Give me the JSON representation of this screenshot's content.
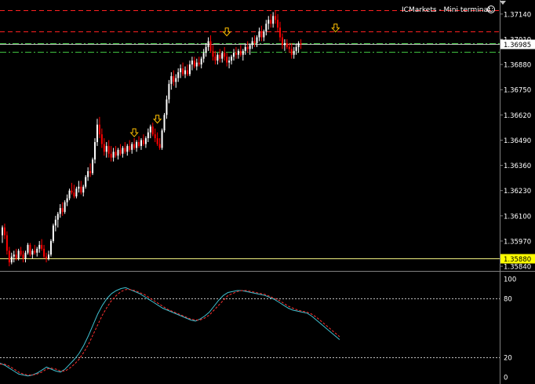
{
  "window": {
    "title": "ICMarkets - Mini terminal",
    "smiley_icon": "smiley-face-icon"
  },
  "colors": {
    "background": "#000000",
    "bull_candle": "#ffffff",
    "bear_candle": "#ff0000",
    "resistance_line": "#ff2020",
    "support_line": "#40c040",
    "current_price_line": "#ffffff",
    "bid_line": "#ffffff",
    "low_price_line": "#f0f080",
    "low_price_tag_bg": "#ffff00",
    "arrow_color": "#ffc000",
    "stoch_main": "#40c0d0",
    "stoch_signal": "#ff3030",
    "axis_text": "#ffffff"
  },
  "chart_data": [
    {
      "type": "candlestick",
      "title": "",
      "price_axis_ticks": [
        "1.37140",
        "1.37010",
        "1.36880",
        "1.36750",
        "1.36620",
        "1.36490",
        "1.36360",
        "1.36230",
        "1.36100",
        "1.35970",
        "1.35840"
      ],
      "ylim": [
        1.3582,
        1.3718
      ],
      "current_price": "1.36985",
      "current_price_value": 1.36985,
      "low_price_tag": "1.35880",
      "low_price_value": 1.3588,
      "horizontal_levels": [
        {
          "kind": "resistance",
          "value": 1.3716
        },
        {
          "kind": "resistance",
          "value": 1.3705
        },
        {
          "kind": "support",
          "value": 1.3699
        },
        {
          "kind": "support",
          "value": 1.36945
        }
      ],
      "down_arrows": [
        {
          "bar": 57,
          "price": 1.3652
        },
        {
          "bar": 67,
          "price": 1.3659
        },
        {
          "bar": 97,
          "price": 1.3704
        },
        {
          "bar": 144,
          "price": 1.3706
        }
      ],
      "bars": [
        [
          1.36,
          1.3605,
          1.3596,
          1.3604
        ],
        [
          1.3604,
          1.3606,
          1.3598,
          1.36
        ],
        [
          1.36,
          1.3602,
          1.359,
          1.3592
        ],
        [
          1.3592,
          1.3594,
          1.3584,
          1.3586
        ],
        [
          1.3586,
          1.3591,
          1.3585,
          1.3589
        ],
        [
          1.3589,
          1.3592,
          1.3586,
          1.359
        ],
        [
          1.359,
          1.3593,
          1.3587,
          1.3588
        ],
        [
          1.3588,
          1.3593,
          1.3587,
          1.3592
        ],
        [
          1.3592,
          1.3594,
          1.3589,
          1.359
        ],
        [
          1.359,
          1.3592,
          1.3586,
          1.3588
        ],
        [
          1.3588,
          1.3592,
          1.3586,
          1.3591
        ],
        [
          1.3591,
          1.3596,
          1.359,
          1.3595
        ],
        [
          1.3595,
          1.3596,
          1.3589,
          1.359
        ],
        [
          1.359,
          1.3593,
          1.3588,
          1.3592
        ],
        [
          1.3592,
          1.3595,
          1.359,
          1.3591
        ],
        [
          1.3591,
          1.3594,
          1.3589,
          1.3593
        ],
        [
          1.3593,
          1.3597,
          1.3591,
          1.3595
        ],
        [
          1.3595,
          1.3598,
          1.3592,
          1.3593
        ],
        [
          1.3593,
          1.3595,
          1.3588,
          1.3589
        ],
        [
          1.3589,
          1.3591,
          1.3586,
          1.3588
        ],
        [
          1.3588,
          1.3592,
          1.3587,
          1.359
        ],
        [
          1.359,
          1.3598,
          1.3589,
          1.3597
        ],
        [
          1.3597,
          1.3606,
          1.3596,
          1.3605
        ],
        [
          1.3605,
          1.361,
          1.3602,
          1.3608
        ],
        [
          1.3608,
          1.3612,
          1.3604,
          1.3611
        ],
        [
          1.3611,
          1.3616,
          1.3609,
          1.3614
        ],
        [
          1.3614,
          1.3617,
          1.361,
          1.3612
        ],
        [
          1.3612,
          1.3618,
          1.3611,
          1.3617
        ],
        [
          1.3617,
          1.3621,
          1.3615,
          1.3619
        ],
        [
          1.3619,
          1.3624,
          1.3618,
          1.3623
        ],
        [
          1.3623,
          1.3627,
          1.3621,
          1.3622
        ],
        [
          1.3622,
          1.3626,
          1.3619,
          1.362
        ],
        [
          1.362,
          1.3625,
          1.3619,
          1.3624
        ],
        [
          1.3624,
          1.3628,
          1.3622,
          1.3625
        ],
        [
          1.3625,
          1.3628,
          1.3621,
          1.3622
        ],
        [
          1.3622,
          1.3626,
          1.362,
          1.3625
        ],
        [
          1.3625,
          1.3631,
          1.3624,
          1.363
        ],
        [
          1.363,
          1.3635,
          1.3628,
          1.3633
        ],
        [
          1.3633,
          1.3637,
          1.363,
          1.3632
        ],
        [
          1.3632,
          1.364,
          1.3631,
          1.3639
        ],
        [
          1.3639,
          1.365,
          1.3637,
          1.3648
        ],
        [
          1.3648,
          1.366,
          1.3646,
          1.3657
        ],
        [
          1.3657,
          1.3661,
          1.365,
          1.3652
        ],
        [
          1.3652,
          1.3655,
          1.3645,
          1.3647
        ],
        [
          1.3647,
          1.365,
          1.3641,
          1.3643
        ],
        [
          1.3643,
          1.3648,
          1.364,
          1.3646
        ],
        [
          1.3646,
          1.3649,
          1.364,
          1.3642
        ],
        [
          1.3642,
          1.3646,
          1.3638,
          1.364
        ],
        [
          1.364,
          1.3645,
          1.3638,
          1.3643
        ],
        [
          1.3643,
          1.3646,
          1.364,
          1.3641
        ],
        [
          1.3641,
          1.3645,
          1.3639,
          1.3644
        ],
        [
          1.3644,
          1.3647,
          1.3641,
          1.3642
        ],
        [
          1.3642,
          1.3646,
          1.364,
          1.3645
        ],
        [
          1.3645,
          1.3648,
          1.3642,
          1.3643
        ],
        [
          1.3643,
          1.3647,
          1.3641,
          1.3646
        ],
        [
          1.3646,
          1.3649,
          1.3643,
          1.3644
        ],
        [
          1.3644,
          1.3648,
          1.3642,
          1.3647
        ],
        [
          1.3647,
          1.365,
          1.3644,
          1.3645
        ],
        [
          1.3645,
          1.3649,
          1.3643,
          1.3648
        ],
        [
          1.3648,
          1.3651,
          1.3645,
          1.3646
        ],
        [
          1.3646,
          1.365,
          1.3644,
          1.3649
        ],
        [
          1.3649,
          1.3652,
          1.3646,
          1.3647
        ],
        [
          1.3647,
          1.3651,
          1.3645,
          1.365
        ],
        [
          1.365,
          1.3655,
          1.3648,
          1.3653
        ],
        [
          1.3653,
          1.3657,
          1.365,
          1.3656
        ],
        [
          1.3656,
          1.3658,
          1.3651,
          1.3652
        ],
        [
          1.3652,
          1.3655,
          1.3648,
          1.365
        ],
        [
          1.365,
          1.3653,
          1.3646,
          1.3647
        ],
        [
          1.3647,
          1.365,
          1.3644,
          1.3645
        ],
        [
          1.3645,
          1.3655,
          1.3644,
          1.3654
        ],
        [
          1.3654,
          1.3663,
          1.3653,
          1.3662
        ],
        [
          1.3662,
          1.3672,
          1.366,
          1.367
        ],
        [
          1.367,
          1.368,
          1.3668,
          1.3678
        ],
        [
          1.3678,
          1.3684,
          1.3675,
          1.3682
        ],
        [
          1.3682,
          1.3685,
          1.3677,
          1.3679
        ],
        [
          1.3679,
          1.3683,
          1.3676,
          1.3681
        ],
        [
          1.3681,
          1.3686,
          1.3679,
          1.3684
        ],
        [
          1.3684,
          1.3688,
          1.3681,
          1.3686
        ],
        [
          1.3686,
          1.3689,
          1.3682,
          1.3683
        ],
        [
          1.3683,
          1.3687,
          1.3681,
          1.3685
        ],
        [
          1.3685,
          1.3688,
          1.3682,
          1.3683
        ],
        [
          1.3683,
          1.369,
          1.3682,
          1.3688
        ],
        [
          1.3688,
          1.3692,
          1.3685,
          1.369
        ],
        [
          1.369,
          1.3692,
          1.3686,
          1.3687
        ],
        [
          1.3687,
          1.3691,
          1.3685,
          1.3689
        ],
        [
          1.3689,
          1.3692,
          1.3687,
          1.3688
        ],
        [
          1.3688,
          1.3692,
          1.3686,
          1.3691
        ],
        [
          1.3691,
          1.3696,
          1.3689,
          1.3694
        ],
        [
          1.3694,
          1.3699,
          1.3692,
          1.3697
        ],
        [
          1.3697,
          1.3702,
          1.3695,
          1.37
        ],
        [
          1.37,
          1.3703,
          1.3694,
          1.3695
        ],
        [
          1.3695,
          1.3698,
          1.369,
          1.3692
        ],
        [
          1.3692,
          1.3695,
          1.3688,
          1.369
        ],
        [
          1.369,
          1.3694,
          1.3688,
          1.3693
        ],
        [
          1.3693,
          1.3696,
          1.3689,
          1.3691
        ],
        [
          1.3691,
          1.3695,
          1.3689,
          1.3694
        ],
        [
          1.3694,
          1.3697,
          1.369,
          1.3692
        ],
        [
          1.3692,
          1.3694,
          1.3687,
          1.3689
        ],
        [
          1.3689,
          1.3692,
          1.3686,
          1.369
        ],
        [
          1.369,
          1.3693,
          1.3688,
          1.3692
        ],
        [
          1.3692,
          1.3696,
          1.369,
          1.3694
        ],
        [
          1.3694,
          1.3697,
          1.3691,
          1.3693
        ],
        [
          1.3693,
          1.3696,
          1.3691,
          1.3695
        ],
        [
          1.3695,
          1.3698,
          1.3692,
          1.3693
        ],
        [
          1.3693,
          1.3696,
          1.369,
          1.3695
        ],
        [
          1.3695,
          1.3699,
          1.3693,
          1.3697
        ],
        [
          1.3697,
          1.37,
          1.3694,
          1.3696
        ],
        [
          1.3696,
          1.3699,
          1.3693,
          1.3698
        ],
        [
          1.3698,
          1.3702,
          1.3696,
          1.37
        ],
        [
          1.37,
          1.3703,
          1.3697,
          1.3699
        ],
        [
          1.3699,
          1.3703,
          1.3697,
          1.3702
        ],
        [
          1.3702,
          1.3707,
          1.37,
          1.3705
        ],
        [
          1.3705,
          1.3708,
          1.37,
          1.3702
        ],
        [
          1.3702,
          1.3706,
          1.37,
          1.3705
        ],
        [
          1.3705,
          1.3711,
          1.3703,
          1.3709
        ],
        [
          1.3709,
          1.3713,
          1.3706,
          1.3711
        ],
        [
          1.3711,
          1.3714,
          1.3707,
          1.3709
        ],
        [
          1.3709,
          1.3715,
          1.3707,
          1.3713
        ],
        [
          1.3713,
          1.3716,
          1.3709,
          1.3711
        ],
        [
          1.3711,
          1.3714,
          1.3705,
          1.3707
        ],
        [
          1.3707,
          1.371,
          1.37,
          1.3702
        ],
        [
          1.3702,
          1.3704,
          1.3696,
          1.3698
        ],
        [
          1.3698,
          1.3701,
          1.3695,
          1.3699
        ],
        [
          1.3699,
          1.3701,
          1.3696,
          1.3697
        ],
        [
          1.3697,
          1.3699,
          1.3694,
          1.3696
        ],
        [
          1.3696,
          1.3699,
          1.3691,
          1.3693
        ],
        [
          1.3693,
          1.3697,
          1.3691,
          1.3695
        ],
        [
          1.3695,
          1.3699,
          1.3693,
          1.3697
        ],
        [
          1.3697,
          1.37,
          1.3694,
          1.3699
        ],
        [
          1.3699,
          1.3701,
          1.3696,
          1.36985
        ]
      ]
    },
    {
      "type": "line",
      "title": "",
      "y_axis_ticks": [
        "100",
        "80",
        "20",
        "0"
      ],
      "ylim": [
        0,
        100
      ],
      "levels": [
        80,
        20
      ],
      "series": [
        {
          "role": "main",
          "values": [
            14,
            12,
            9,
            6,
            3,
            2,
            1,
            2,
            4,
            7,
            10,
            8,
            6,
            5,
            8,
            13,
            18,
            24,
            32,
            42,
            53,
            64,
            73,
            80,
            85,
            88,
            90,
            91,
            89,
            87,
            85,
            82,
            79,
            76,
            73,
            70,
            68,
            66,
            64,
            62,
            60,
            58,
            57,
            59,
            62,
            66,
            72,
            78,
            83,
            86,
            87,
            88,
            88,
            87,
            86,
            85,
            84,
            83,
            81,
            79,
            76,
            73,
            70,
            68,
            67,
            66,
            65,
            62,
            58,
            54,
            50,
            46,
            42,
            38
          ]
        },
        {
          "role": "signal",
          "values": [
            13,
            13,
            11,
            8,
            5,
            3,
            2,
            2,
            3,
            5,
            8,
            9,
            8,
            6,
            6,
            9,
            13,
            18,
            25,
            33,
            43,
            53,
            63,
            71,
            78,
            83,
            87,
            89,
            89,
            88,
            86,
            84,
            81,
            78,
            75,
            72,
            69,
            67,
            65,
            63,
            61,
            59,
            58,
            58,
            60,
            63,
            68,
            73,
            78,
            83,
            85,
            87,
            88,
            88,
            87,
            86,
            85,
            84,
            82,
            80,
            78,
            75,
            72,
            70,
            68,
            67,
            66,
            64,
            61,
            57,
            53,
            49,
            45,
            41
          ]
        }
      ]
    }
  ]
}
